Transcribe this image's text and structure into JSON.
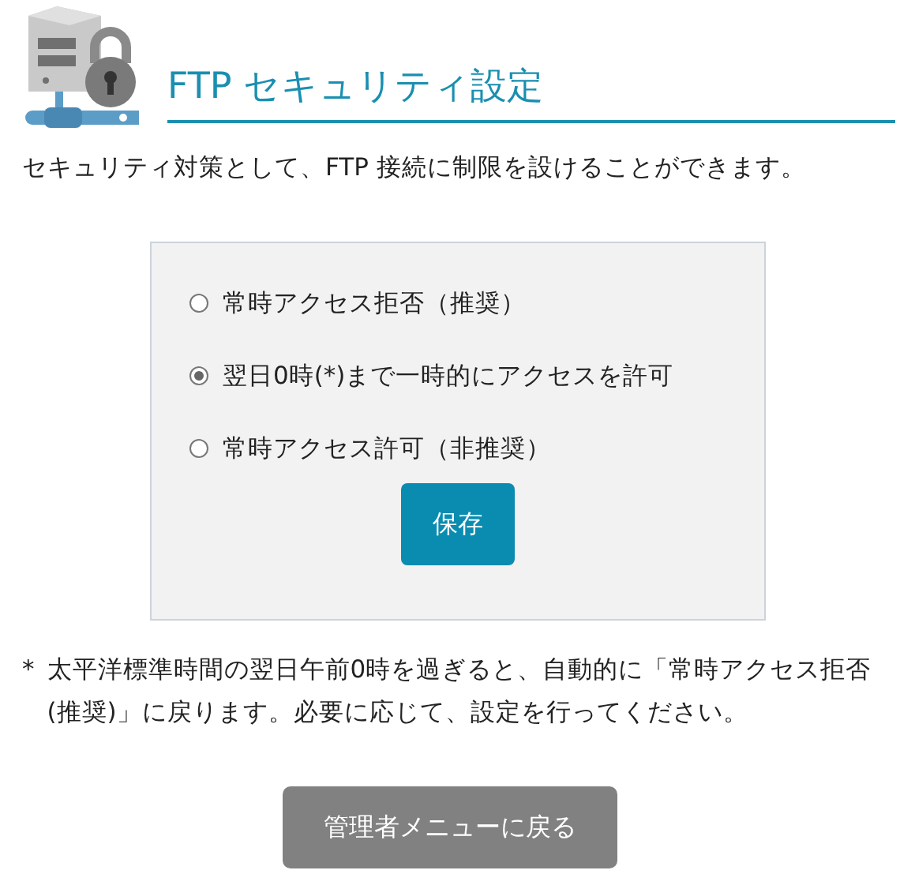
{
  "title": "FTP セキュリティ設定",
  "intro": "セキュリティ対策として、FTP 接続に制限を設けることができます。",
  "options": [
    {
      "label": "常時アクセス拒否（推奨）",
      "selected": false
    },
    {
      "label": "翌日0時(*)まで一時的にアクセスを許可",
      "selected": true
    },
    {
      "label": "常時アクセス許可（非推奨）",
      "selected": false
    }
  ],
  "save_button": "保存",
  "note": {
    "mark": "*",
    "text": "太平洋標準時間の翌日午前0時を過ぎると、自動的に「常時アクセス拒否(推奨)」に戻ります。必要に応じて、設定を行ってください。"
  },
  "back_button": "管理者メニューに戻る"
}
